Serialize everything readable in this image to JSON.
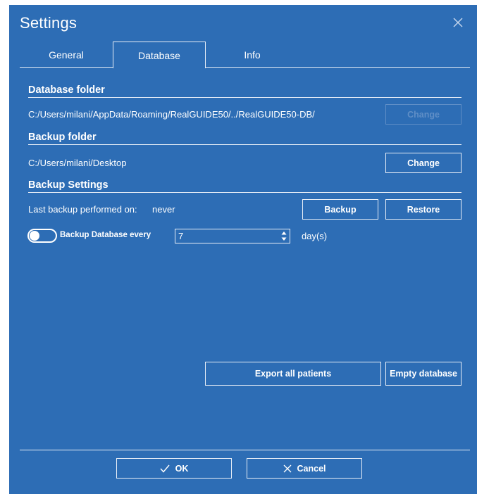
{
  "dialog": {
    "title": "Settings"
  },
  "tabs": [
    {
      "label": "General",
      "active": false
    },
    {
      "label": "Database",
      "active": true
    },
    {
      "label": "Info",
      "active": false
    }
  ],
  "database_folder": {
    "title": "Database folder",
    "path": "C:/Users/milani/AppData/Roaming/RealGUIDE50/../RealGUIDE50-DB/",
    "change_label": "Change",
    "change_enabled": false
  },
  "backup_folder": {
    "title": "Backup folder",
    "path": "C:/Users/milani/Desktop",
    "change_label": "Change"
  },
  "backup_settings": {
    "title": "Backup Settings",
    "last_backup_label": "Last backup performed on:",
    "last_backup_value": "never",
    "backup_label": "Backup",
    "restore_label": "Restore",
    "auto_backup_label": "Backup Database every",
    "auto_backup_enabled": false,
    "interval_value": "7",
    "interval_unit": "day(s)"
  },
  "actions": {
    "export_label": "Export all patients",
    "empty_label": "Empty database"
  },
  "footer": {
    "ok_label": "OK",
    "cancel_label": "Cancel"
  },
  "colors": {
    "background": "#2d6db5",
    "foreground": "#ffffff",
    "disabled": "#5f8ec6"
  },
  "icons": {
    "close": "close-icon",
    "ok": "checkmark-icon",
    "cancel": "x-icon",
    "spin": "spin-arrows-icon"
  }
}
